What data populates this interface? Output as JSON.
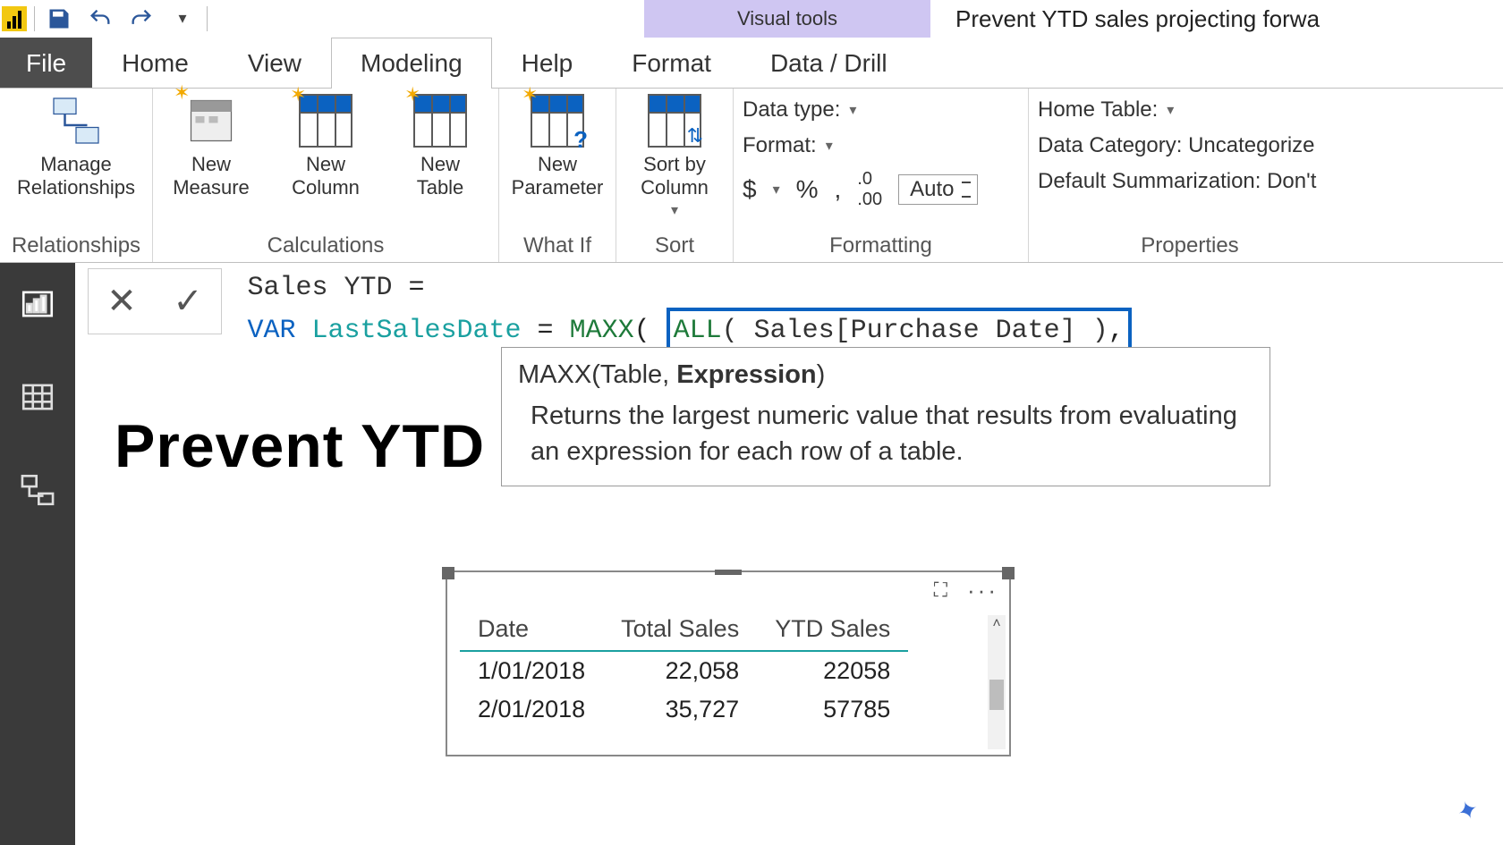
{
  "app": {
    "contextual_tab": "Visual tools",
    "doc_title": "Prevent YTD sales projecting forwa"
  },
  "tabs": {
    "file": "File",
    "home": "Home",
    "view": "View",
    "modeling": "Modeling",
    "help": "Help",
    "format": "Format",
    "datadrill": "Data / Drill"
  },
  "ribbon": {
    "relationships": {
      "manage": "Manage\nRelationships",
      "group": "Relationships"
    },
    "calculations": {
      "measure": "New\nMeasure",
      "column": "New\nColumn",
      "table": "New\nTable",
      "group": "Calculations"
    },
    "whatif": {
      "parameter": "New\nParameter",
      "group": "What If"
    },
    "sort": {
      "sortby": "Sort by\nColumn",
      "group": "Sort"
    },
    "formatting": {
      "datatype_lbl": "Data type:",
      "format_lbl": "Format:",
      "currency": "$",
      "percent": "%",
      "thousands": ",",
      "decimals_icon": ".00",
      "auto": "Auto",
      "group": "Formatting"
    },
    "properties": {
      "hometable": "Home Table:",
      "datacat": "Data Category: Uncategorize",
      "summ": "Default Summarization: Don't",
      "group": "Properties"
    }
  },
  "formula": {
    "line1_measure": "Sales YTD",
    "eq": " = ",
    "var_kw": "VAR",
    "var_name": "LastSalesDate",
    "assign": " = ",
    "fn_maxx": "MAXX",
    "open": "(",
    "fn_all": "ALL",
    "all_arg": "( Sales[Purchase Date] )",
    "comma": ","
  },
  "tooltip": {
    "sig_fn": "MAXX",
    "sig_args_pre": "(Table, ",
    "sig_args_bold": "Expression",
    "sig_args_post": ")",
    "desc": "Returns the largest numeric value that results from evaluating an expression for each row of a table."
  },
  "report": {
    "title": "Prevent YTD Results Projecting Forw"
  },
  "table_visual": {
    "columns": [
      "Date",
      "Total Sales",
      "YTD Sales"
    ],
    "rows": [
      {
        "date": "1/01/2018",
        "total": "22,058",
        "ytd": "22058"
      },
      {
        "date": "2/01/2018",
        "total": "35,727",
        "ytd": "57785"
      }
    ]
  }
}
